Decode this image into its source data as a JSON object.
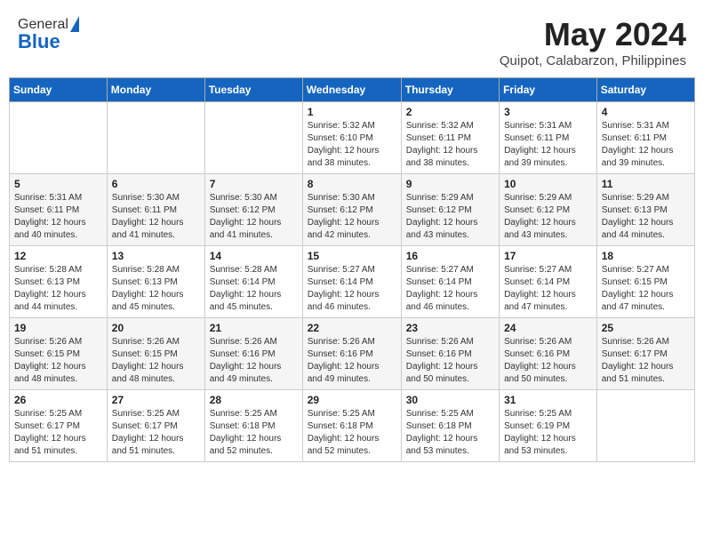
{
  "logo": {
    "general": "General",
    "blue": "Blue"
  },
  "title": "May 2024",
  "subtitle": "Quipot, Calabarzon, Philippines",
  "days_of_week": [
    "Sunday",
    "Monday",
    "Tuesday",
    "Wednesday",
    "Thursday",
    "Friday",
    "Saturday"
  ],
  "weeks": [
    [
      {
        "day": "",
        "info": ""
      },
      {
        "day": "",
        "info": ""
      },
      {
        "day": "",
        "info": ""
      },
      {
        "day": "1",
        "info": "Sunrise: 5:32 AM\nSunset: 6:10 PM\nDaylight: 12 hours and 38 minutes."
      },
      {
        "day": "2",
        "info": "Sunrise: 5:32 AM\nSunset: 6:11 PM\nDaylight: 12 hours and 38 minutes."
      },
      {
        "day": "3",
        "info": "Sunrise: 5:31 AM\nSunset: 6:11 PM\nDaylight: 12 hours and 39 minutes."
      },
      {
        "day": "4",
        "info": "Sunrise: 5:31 AM\nSunset: 6:11 PM\nDaylight: 12 hours and 39 minutes."
      }
    ],
    [
      {
        "day": "5",
        "info": "Sunrise: 5:31 AM\nSunset: 6:11 PM\nDaylight: 12 hours and 40 minutes."
      },
      {
        "day": "6",
        "info": "Sunrise: 5:30 AM\nSunset: 6:11 PM\nDaylight: 12 hours and 41 minutes."
      },
      {
        "day": "7",
        "info": "Sunrise: 5:30 AM\nSunset: 6:12 PM\nDaylight: 12 hours and 41 minutes."
      },
      {
        "day": "8",
        "info": "Sunrise: 5:30 AM\nSunset: 6:12 PM\nDaylight: 12 hours and 42 minutes."
      },
      {
        "day": "9",
        "info": "Sunrise: 5:29 AM\nSunset: 6:12 PM\nDaylight: 12 hours and 43 minutes."
      },
      {
        "day": "10",
        "info": "Sunrise: 5:29 AM\nSunset: 6:12 PM\nDaylight: 12 hours and 43 minutes."
      },
      {
        "day": "11",
        "info": "Sunrise: 5:29 AM\nSunset: 6:13 PM\nDaylight: 12 hours and 44 minutes."
      }
    ],
    [
      {
        "day": "12",
        "info": "Sunrise: 5:28 AM\nSunset: 6:13 PM\nDaylight: 12 hours and 44 minutes."
      },
      {
        "day": "13",
        "info": "Sunrise: 5:28 AM\nSunset: 6:13 PM\nDaylight: 12 hours and 45 minutes."
      },
      {
        "day": "14",
        "info": "Sunrise: 5:28 AM\nSunset: 6:14 PM\nDaylight: 12 hours and 45 minutes."
      },
      {
        "day": "15",
        "info": "Sunrise: 5:27 AM\nSunset: 6:14 PM\nDaylight: 12 hours and 46 minutes."
      },
      {
        "day": "16",
        "info": "Sunrise: 5:27 AM\nSunset: 6:14 PM\nDaylight: 12 hours and 46 minutes."
      },
      {
        "day": "17",
        "info": "Sunrise: 5:27 AM\nSunset: 6:14 PM\nDaylight: 12 hours and 47 minutes."
      },
      {
        "day": "18",
        "info": "Sunrise: 5:27 AM\nSunset: 6:15 PM\nDaylight: 12 hours and 47 minutes."
      }
    ],
    [
      {
        "day": "19",
        "info": "Sunrise: 5:26 AM\nSunset: 6:15 PM\nDaylight: 12 hours and 48 minutes."
      },
      {
        "day": "20",
        "info": "Sunrise: 5:26 AM\nSunset: 6:15 PM\nDaylight: 12 hours and 48 minutes."
      },
      {
        "day": "21",
        "info": "Sunrise: 5:26 AM\nSunset: 6:16 PM\nDaylight: 12 hours and 49 minutes."
      },
      {
        "day": "22",
        "info": "Sunrise: 5:26 AM\nSunset: 6:16 PM\nDaylight: 12 hours and 49 minutes."
      },
      {
        "day": "23",
        "info": "Sunrise: 5:26 AM\nSunset: 6:16 PM\nDaylight: 12 hours and 50 minutes."
      },
      {
        "day": "24",
        "info": "Sunrise: 5:26 AM\nSunset: 6:16 PM\nDaylight: 12 hours and 50 minutes."
      },
      {
        "day": "25",
        "info": "Sunrise: 5:26 AM\nSunset: 6:17 PM\nDaylight: 12 hours and 51 minutes."
      }
    ],
    [
      {
        "day": "26",
        "info": "Sunrise: 5:25 AM\nSunset: 6:17 PM\nDaylight: 12 hours and 51 minutes."
      },
      {
        "day": "27",
        "info": "Sunrise: 5:25 AM\nSunset: 6:17 PM\nDaylight: 12 hours and 51 minutes."
      },
      {
        "day": "28",
        "info": "Sunrise: 5:25 AM\nSunset: 6:18 PM\nDaylight: 12 hours and 52 minutes."
      },
      {
        "day": "29",
        "info": "Sunrise: 5:25 AM\nSunset: 6:18 PM\nDaylight: 12 hours and 52 minutes."
      },
      {
        "day": "30",
        "info": "Sunrise: 5:25 AM\nSunset: 6:18 PM\nDaylight: 12 hours and 53 minutes."
      },
      {
        "day": "31",
        "info": "Sunrise: 5:25 AM\nSunset: 6:19 PM\nDaylight: 12 hours and 53 minutes."
      },
      {
        "day": "",
        "info": ""
      }
    ]
  ]
}
